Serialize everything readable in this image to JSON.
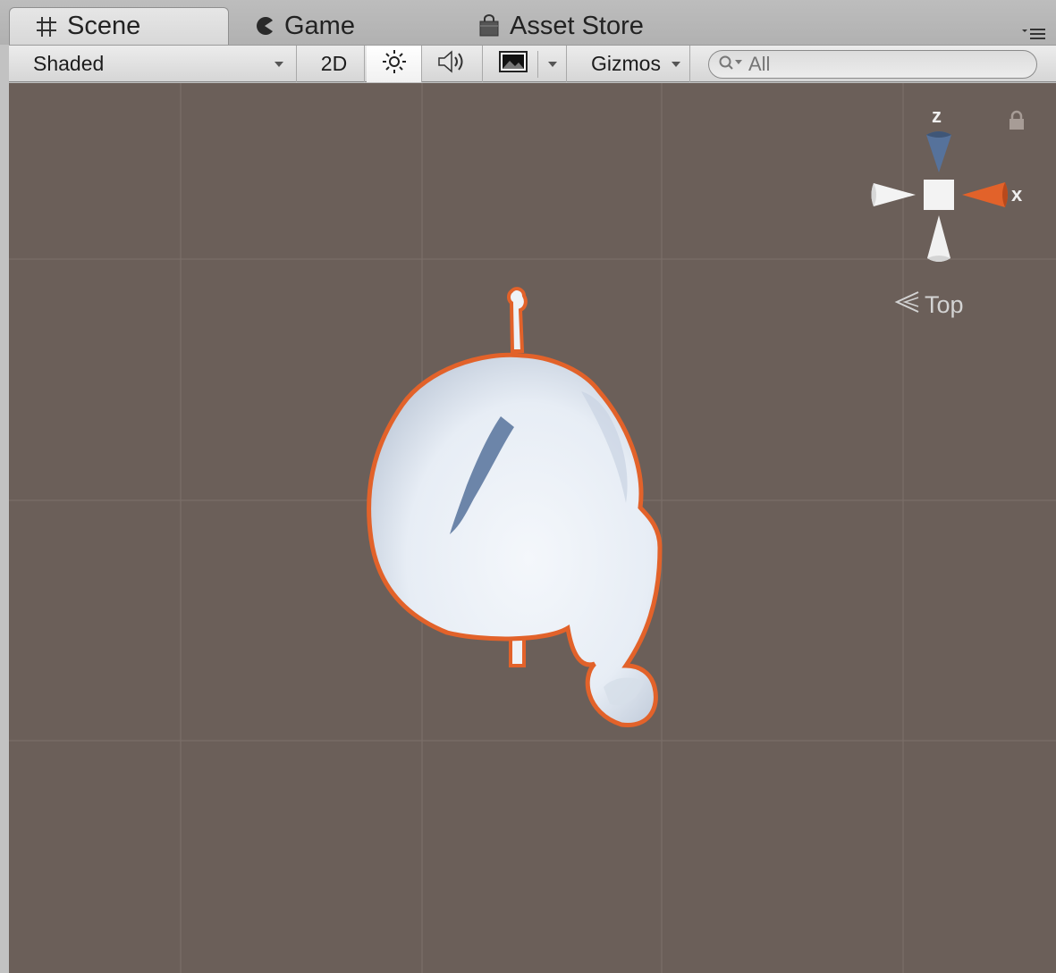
{
  "tabs": [
    {
      "label": "Scene",
      "icon": "grid-hash-icon",
      "active": true
    },
    {
      "label": "Game",
      "icon": "pacman-icon",
      "active": false
    },
    {
      "label": "Asset Store",
      "icon": "shopping-bag-icon",
      "active": false
    }
  ],
  "toolbar": {
    "draw_mode": "Shaded",
    "mode_2d": "2D",
    "gizmos": "Gizmos",
    "search_placeholder": "All"
  },
  "gizmo": {
    "z_label": "z",
    "x_label": "x",
    "view_label": "Top",
    "colors": {
      "x": "#e2622a",
      "z": "#56729b",
      "neutral": "#f3f3f3"
    }
  },
  "scene": {
    "selection_outline_color": "#e2622a",
    "background": "#6b5f59"
  }
}
